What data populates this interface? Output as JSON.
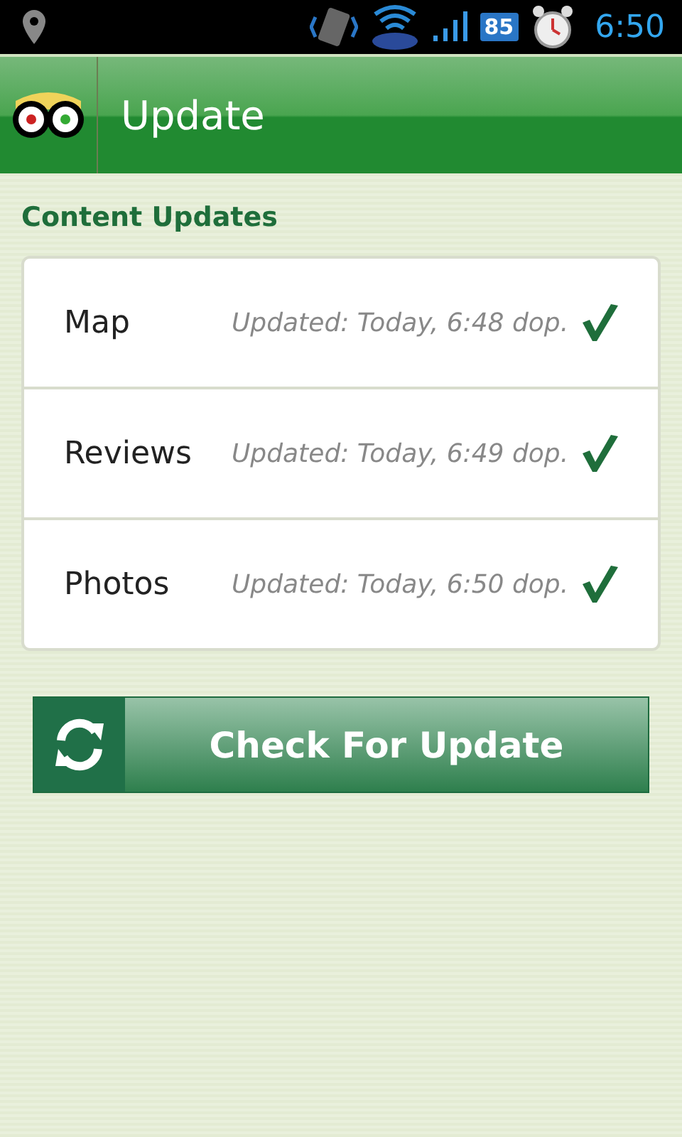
{
  "status_bar": {
    "battery": "85",
    "time": "6:50"
  },
  "header": {
    "title": "Update"
  },
  "section": {
    "title": "Content Updates"
  },
  "items": [
    {
      "name": "Map",
      "status": "Updated: Today, 6:48 dop.",
      "checked": true
    },
    {
      "name": "Reviews",
      "status": "Updated: Today, 6:49 dop.",
      "checked": true
    },
    {
      "name": "Photos",
      "status": "Updated: Today, 6:50 dop.",
      "checked": true
    }
  ],
  "button": {
    "label": "Check For Update"
  }
}
